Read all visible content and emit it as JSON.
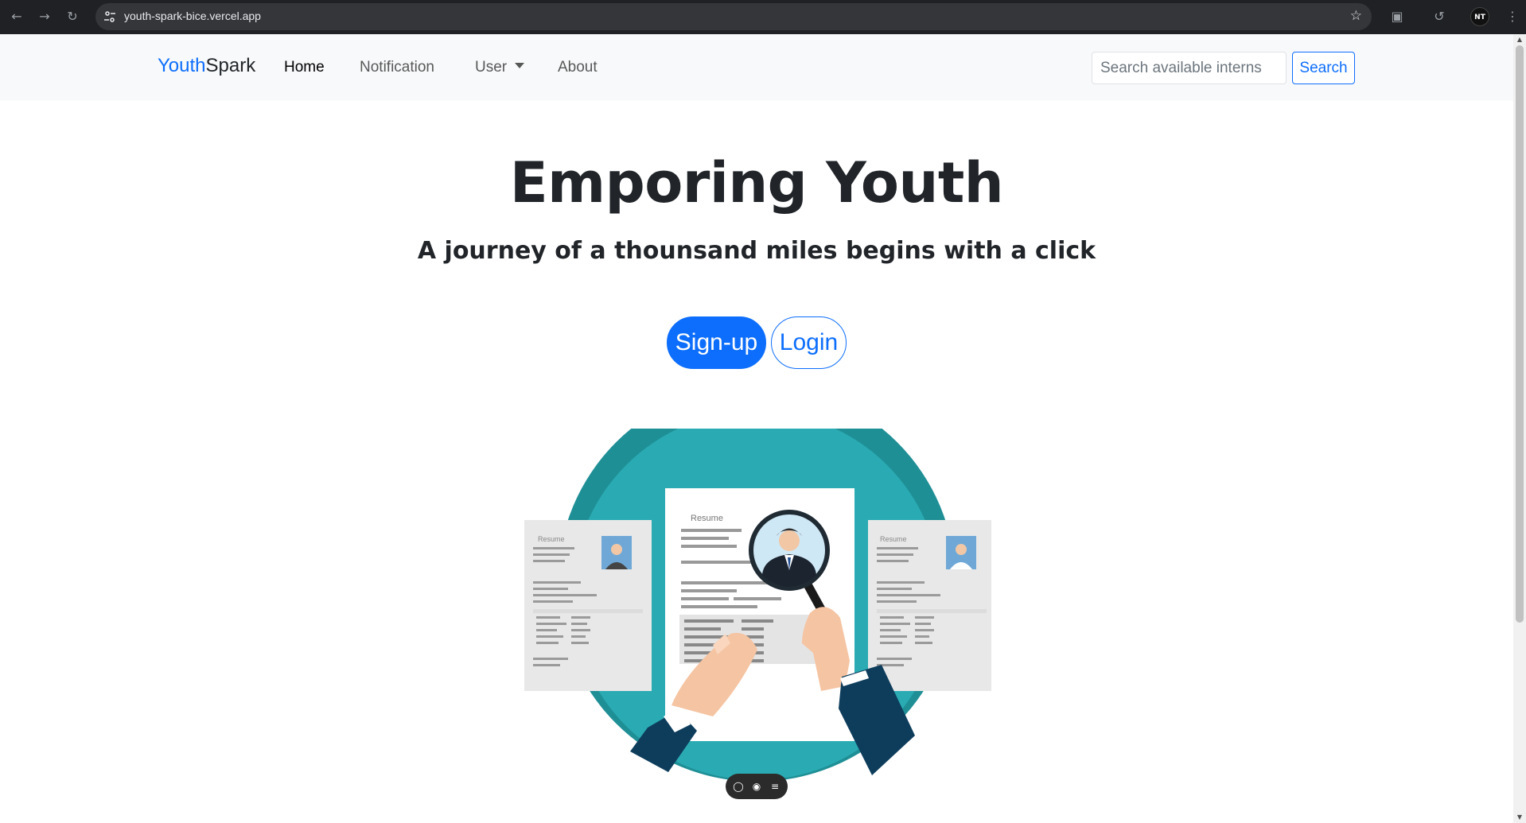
{
  "browser": {
    "url": "youth-spark-bice.vercel.app",
    "profile_initials": "NT"
  },
  "navbar": {
    "brand_part1": "Youth",
    "brand_part2": "Spark",
    "links": [
      {
        "label": "Home",
        "active": true
      },
      {
        "label": "Notification",
        "active": false
      },
      {
        "label": "User",
        "active": false,
        "dropdown": true
      },
      {
        "label": "About",
        "active": false
      }
    ],
    "search_placeholder": "Search available interns",
    "search_button": "Search"
  },
  "hero": {
    "title": "Emporing Youth",
    "subtitle": "A journey of a thounsand miles begins with a click",
    "signup_label": "Sign-up",
    "login_label": "Login"
  },
  "illustration": {
    "resume_left": "Resume",
    "resume_center": "Resume",
    "resume_right": "Resume"
  },
  "colors": {
    "primary": "#0d6efd",
    "navbar_bg": "#f8f9fa",
    "teal_outer": "#1f8f96",
    "teal_inner": "#2aabb3"
  }
}
